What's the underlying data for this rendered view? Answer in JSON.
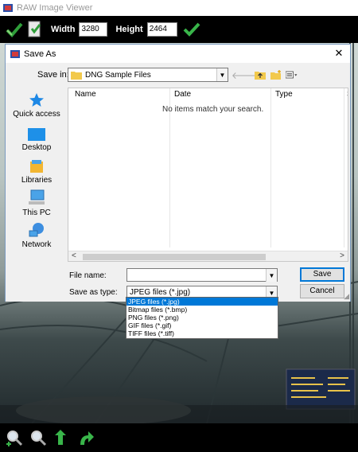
{
  "app": {
    "title": "RAW Image Viewer"
  },
  "toolbar": {
    "width_label": "Width",
    "width_value": "3280",
    "height_label": "Height",
    "height_value": "2464"
  },
  "dialog": {
    "title": "Save As",
    "save_in_label": "Save in:",
    "save_in_value": "DNG Sample Files",
    "places": [
      {
        "label": "Quick access",
        "icon": "star-icon"
      },
      {
        "label": "Desktop",
        "icon": "desktop-icon"
      },
      {
        "label": "Libraries",
        "icon": "libraries-icon"
      },
      {
        "label": "This PC",
        "icon": "computer-icon"
      },
      {
        "label": "Network",
        "icon": "network-icon"
      }
    ],
    "columns": [
      "Name",
      "Date",
      "Type",
      "S"
    ],
    "empty_message": "No items match your search.",
    "file_name_label": "File name:",
    "file_name_value": "",
    "save_as_type_label": "Save as type:",
    "save_as_type_value": "JPEG files (*.jpg)",
    "save_button": "Save",
    "cancel_button": "Cancel",
    "type_options": [
      "JPEG files (*.jpg)",
      "Bitmap files (*.bmp)",
      "PNG files (*.png)",
      "GIF files (*.gif)",
      "TIFF files (*.tiff)"
    ],
    "selected_type_index": 0
  },
  "colors": {
    "accent": "#0078d7",
    "toolbar_bg": "#000000",
    "icon_green": "#3cb043"
  }
}
